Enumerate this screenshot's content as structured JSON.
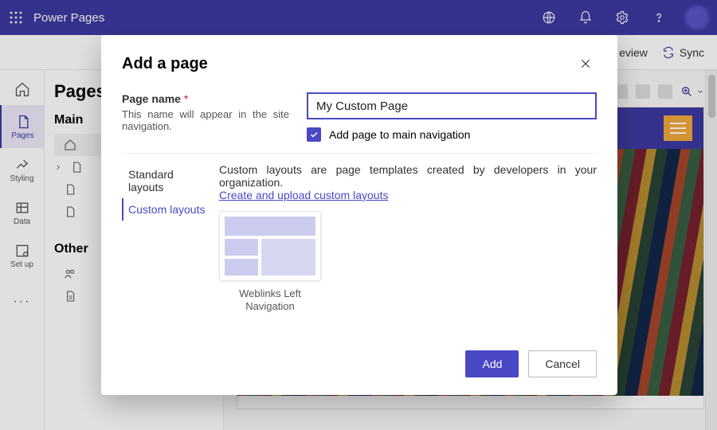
{
  "appbar": {
    "product": "Power Pages"
  },
  "cmdbar": {
    "preview": "eview",
    "sync": "Sync"
  },
  "rail": {
    "pages": "Pages",
    "styling": "Styling",
    "data": "Data",
    "setup": "Set up"
  },
  "sidepanel": {
    "title": "Pages",
    "main_heading": "Main",
    "other_heading": "Other"
  },
  "canvas": {
    "zoom_hint": ""
  },
  "dialog": {
    "title": "Add a page",
    "page_name_label": "Page name",
    "page_name_hint": "This name will appear in the site navigation.",
    "page_name_value": "My Custom Page",
    "add_to_nav_label": "Add page to main navigation",
    "tab_standard": "Standard layouts",
    "tab_custom": "Custom layouts",
    "custom_desc": "Custom layouts are page templates created by developers in your organization.",
    "custom_link": "Create and upload custom layouts",
    "card1": "Weblinks Left Navigation",
    "add_btn": "Add",
    "cancel_btn": "Cancel"
  }
}
